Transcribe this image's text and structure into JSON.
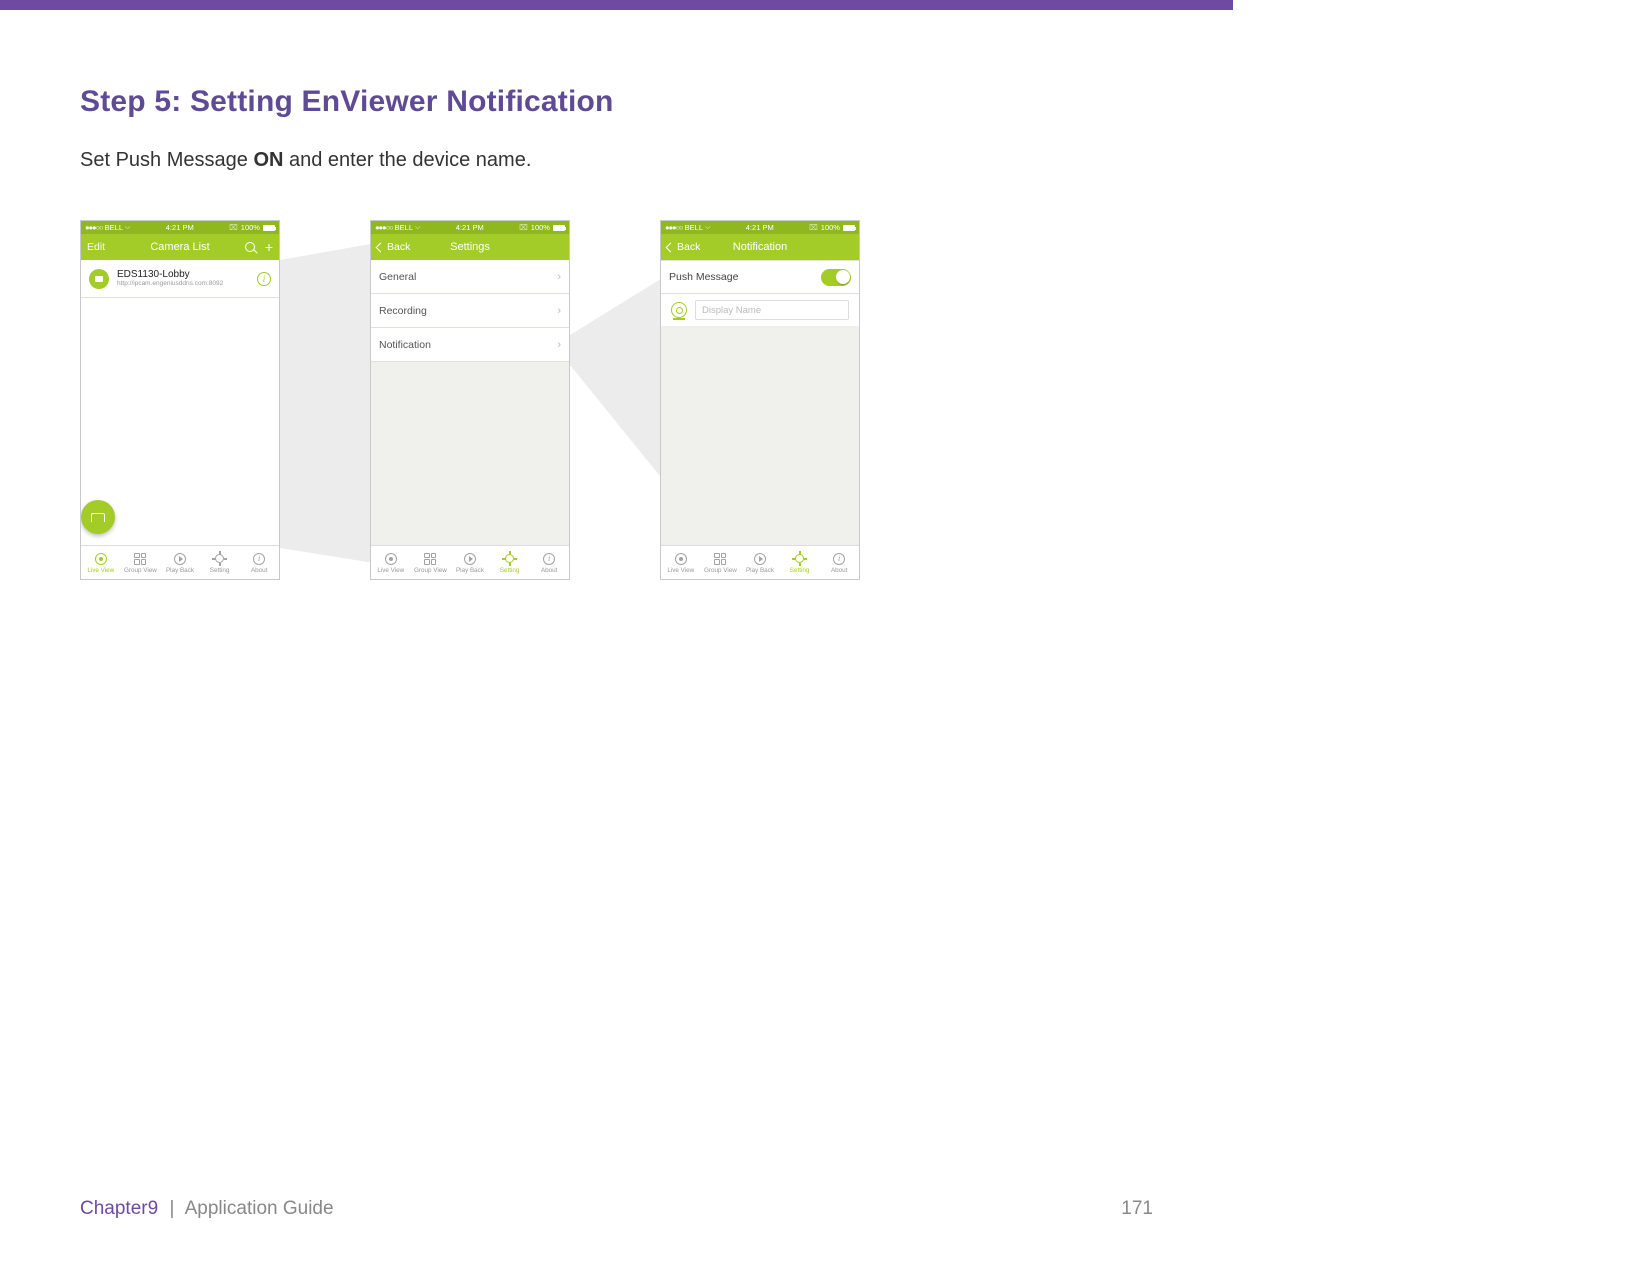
{
  "page": {
    "heading": "Step 5: Setting EnViewer Notification",
    "description_pre": "Set Push Message ",
    "description_bold": "ON",
    "description_post": " and enter the device name."
  },
  "statusbar": {
    "carrier": "BELL",
    "signal_dots": "●●●○○",
    "time": "4:21 PM",
    "battery_pct": "100%"
  },
  "tabs": {
    "live": "Live View",
    "group": "Group View",
    "play": "Play Back",
    "setting": "Setting",
    "about": "About"
  },
  "phone1": {
    "nav_left": "Edit",
    "nav_title": "Camera List",
    "camera_name": "EDS1130-Lobby",
    "camera_url": "http://ipcam.engeniusddns.com:8092"
  },
  "phone2": {
    "nav_back": "Back",
    "nav_title": "Settings",
    "rows": {
      "general": "General",
      "recording": "Recording",
      "notification": "Notification"
    }
  },
  "phone3": {
    "nav_back": "Back",
    "nav_title": "Notification",
    "push_label": "Push Message",
    "display_placeholder": "Display Name"
  },
  "footer": {
    "chapter": "Chapter9",
    "section": "Application Guide",
    "page_number": "171"
  }
}
